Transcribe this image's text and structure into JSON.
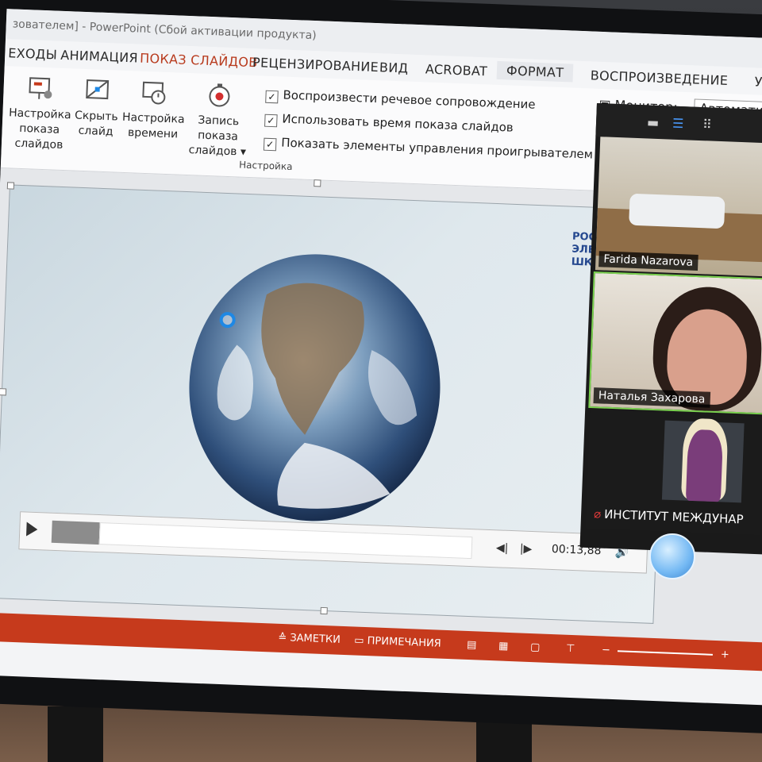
{
  "window": {
    "title": "зователем] - PowerPoint (Сбой активации продукта)"
  },
  "tabs": [
    {
      "label": "ЕХОДЫ"
    },
    {
      "label": "АНИМАЦИЯ"
    },
    {
      "label": "ПОКАЗ СЛАЙДОВ",
      "active": true
    },
    {
      "label": "РЕЦЕНЗИРОВАНИЕ"
    },
    {
      "label": "ВИД"
    },
    {
      "label": "ACROBAT"
    },
    {
      "label": "ФОРМАТ"
    },
    {
      "label": "ВОСПРОИЗВЕДЕНИЕ"
    },
    {
      "label": "У"
    }
  ],
  "ribbon": {
    "setup_show": {
      "line1": "Настройка",
      "line2": "показа слайдов"
    },
    "hide_slide": {
      "line1": "Скрыть",
      "line2": "слайд"
    },
    "rehearse": {
      "line1": "Настройка",
      "line2": "времени"
    },
    "record": {
      "line1": "Запись показа",
      "line2": "слайдов ▾"
    },
    "group_label": "Настройка",
    "checkboxes": [
      {
        "label": "Воспроизвести речевое сопровождение",
        "checked": true
      },
      {
        "label": "Использовать время показа слайдов",
        "checked": true
      },
      {
        "label": "Показать элементы управления проигрывателем",
        "checked": true
      }
    ],
    "monitor_label": "Монитор:",
    "monitor_value": "Автоматиче",
    "check_mark": "✓"
  },
  "slide": {
    "logo_lines": [
      "РОССИЙ",
      "ЭЛЕКТР",
      "ШКОЛА"
    ]
  },
  "player": {
    "time": "00:13,88",
    "prev_icon": "step-back-icon",
    "next_icon": "step-forward-icon",
    "volume_icon": "volume-icon"
  },
  "statusbar": {
    "notes": "ЗАМЕТКИ",
    "comments": "ПРИМЕЧАНИЯ",
    "zoom_minus": "−",
    "zoom_plus": "+"
  },
  "call": {
    "participants": [
      {
        "name": "Farida Nazarova"
      },
      {
        "name": "Наталья Захарова",
        "speaking": true
      },
      {
        "name": "ИНСТИТУТ МЕЖДУНАР",
        "muted": true
      }
    ]
  },
  "colors": {
    "accent": "#b83b1e",
    "statusbar": "#c63a1c",
    "speaking_outline": "#7ad14f"
  }
}
